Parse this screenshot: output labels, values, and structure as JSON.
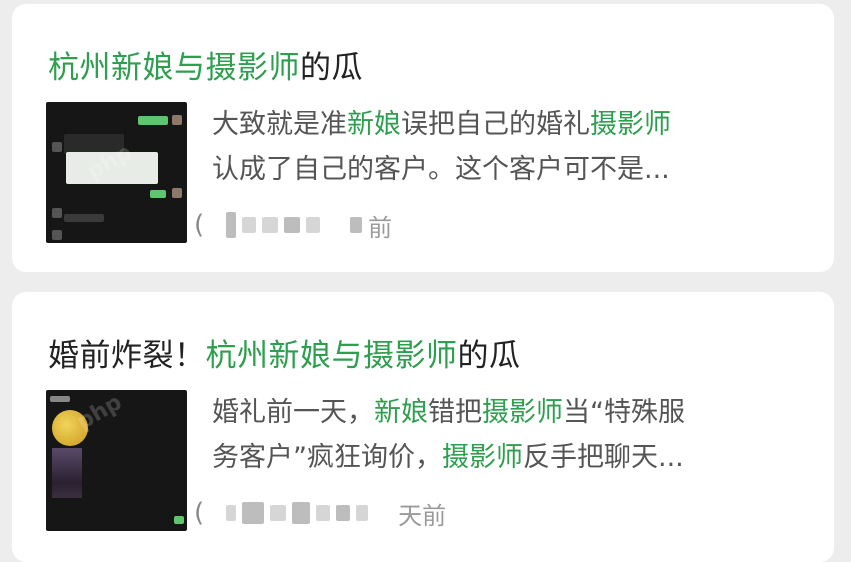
{
  "cards": [
    {
      "title_parts": [
        {
          "text": "杭州新娘与摄影师",
          "hl": true
        },
        {
          "text": "的瓜",
          "hl": false
        }
      ],
      "snippet_line1": [
        {
          "text": "大致就是准",
          "hl": false
        },
        {
          "text": "新娘",
          "hl": true
        },
        {
          "text": "误把自己的婚礼",
          "hl": false
        },
        {
          "text": "摄影师",
          "hl": true
        }
      ],
      "snippet_line2": [
        {
          "text": "认成了自己的客户。这个客户可不是...",
          "hl": false
        }
      ],
      "time_suffix": "前"
    },
    {
      "title_parts": [
        {
          "text": "婚前炸裂！",
          "hl": false
        },
        {
          "text": "杭州新娘与摄影师",
          "hl": true
        },
        {
          "text": "的瓜",
          "hl": false
        }
      ],
      "snippet_line1": [
        {
          "text": "婚礼前一天，",
          "hl": false
        },
        {
          "text": "新娘",
          "hl": true
        },
        {
          "text": "错把",
          "hl": false
        },
        {
          "text": "摄影师",
          "hl": true
        },
        {
          "text": "当“特殊服",
          "hl": false
        }
      ],
      "snippet_line2": [
        {
          "text": "务客户”疯狂询价，",
          "hl": false
        },
        {
          "text": "摄影师",
          "hl": true
        },
        {
          "text": "反手把聊天...",
          "hl": false
        }
      ],
      "time_suffix": "天前"
    }
  ],
  "colors": {
    "highlight": "#2e9e4f",
    "title": "#222222",
    "snippet": "#555555",
    "background": "#ededed"
  }
}
